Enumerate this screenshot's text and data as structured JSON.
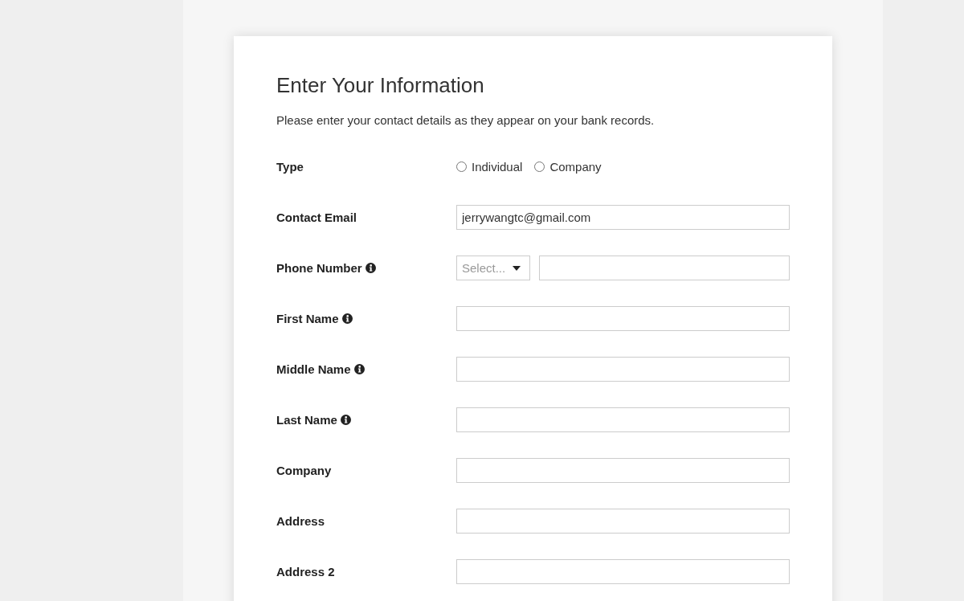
{
  "form": {
    "title": "Enter Your Information",
    "description": "Please enter your contact details as they appear on your bank records.",
    "fields": [
      {
        "kind": "radio",
        "label": "Type",
        "info": false,
        "options": [
          {
            "label": "Individual",
            "selected": false
          },
          {
            "label": "Company",
            "selected": false
          }
        ]
      },
      {
        "kind": "text",
        "label": "Contact Email",
        "info": false,
        "value": "jerrywangtc@gmail.com"
      },
      {
        "kind": "phone",
        "label": "Phone Number",
        "info": true,
        "select": {
          "placeholder": "Select..."
        }
      },
      {
        "kind": "text",
        "label": "First Name",
        "info": true
      },
      {
        "kind": "text",
        "label": "Middle Name",
        "info": true
      },
      {
        "kind": "text",
        "label": "Last Name",
        "info": true
      },
      {
        "kind": "text",
        "label": "Company",
        "info": false
      },
      {
        "kind": "text",
        "label": "Address",
        "info": false
      },
      {
        "kind": "text",
        "label": "Address 2",
        "info": false
      }
    ]
  }
}
